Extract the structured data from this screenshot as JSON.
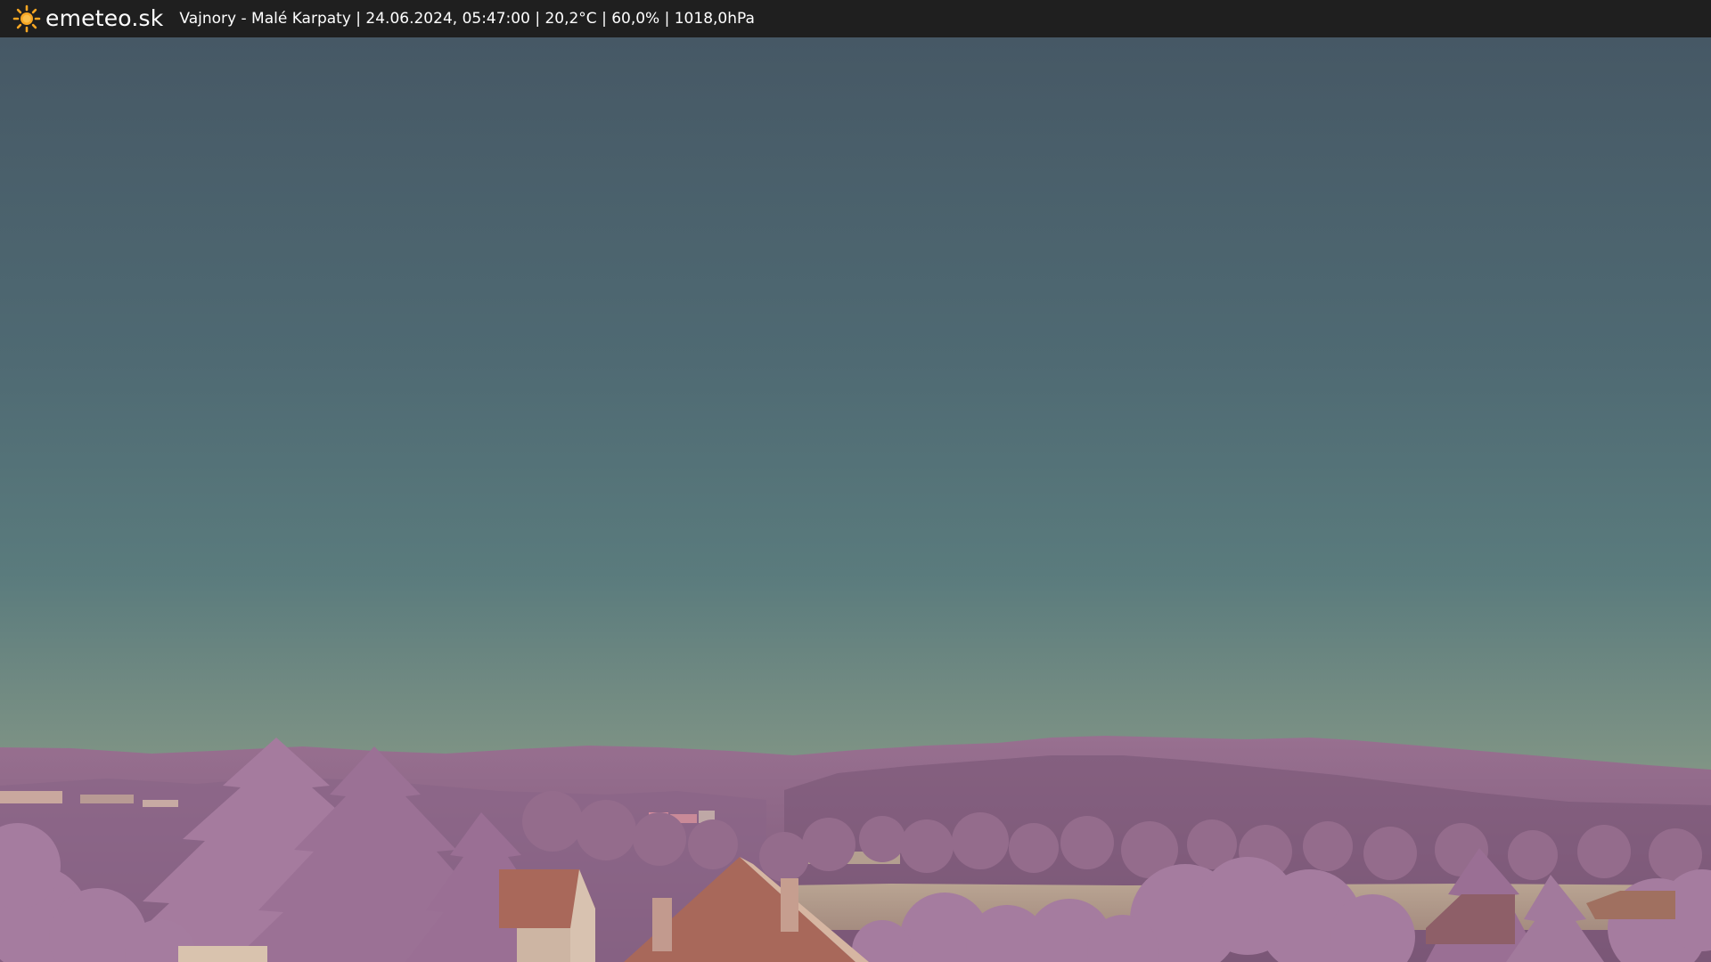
{
  "topbar": {
    "brand_name": "emeteo.sk",
    "brand_icon": "sun-icon",
    "caption": "Vajnory - Malé Karpaty | 24.06.2024, 05:47:00 | 20,2°C | 60,0% | 1018,0hPa"
  },
  "colors": {
    "bar_background": "#1f1f1f",
    "sun": "#f6a623",
    "sky_top": "#465865",
    "sky_middle": "#577b7d",
    "sky_horizon": "#a7a284",
    "foliage": "#9d6f97",
    "roof": "#a8685a"
  }
}
